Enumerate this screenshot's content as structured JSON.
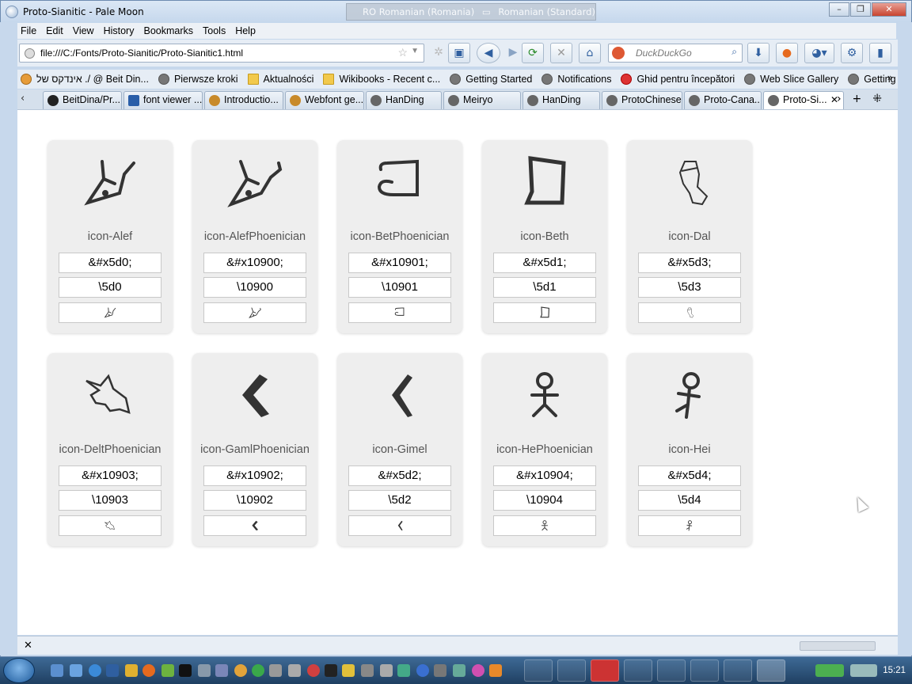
{
  "window": {
    "title": "Proto-Sianitic - Pale Moon",
    "language_bar": {
      "input": "RO Romanian (Romania)",
      "layout": "Romanian (Standard)"
    }
  },
  "menu": [
    "File",
    "Edit",
    "View",
    "History",
    "Bookmarks",
    "Tools",
    "Help"
  ],
  "nav": {
    "url": "file:///C:/Fonts/Proto-Sianitic/Proto-Sianitic1.html",
    "search_placeholder": "DuckDuckGo"
  },
  "bookmarks": [
    {
      "label": "אינדקס של ./ @ Beit Din...",
      "icon": "orange"
    },
    {
      "label": "Pierwsze kroki",
      "icon": "globe"
    },
    {
      "label": "Aktualności",
      "icon": "folder"
    },
    {
      "label": "Wikibooks - Recent c...",
      "icon": "folder"
    },
    {
      "label": "Getting Started",
      "icon": "globe"
    },
    {
      "label": "Notifications",
      "icon": "globe"
    },
    {
      "label": "Ghid pentru începători",
      "icon": "red"
    },
    {
      "label": "Web Slice Gallery",
      "icon": "globe"
    },
    {
      "label": "Getting Started",
      "icon": "globe"
    }
  ],
  "tabs": [
    "BeitDina/Pr...",
    "font viewer ...",
    "Introductio...",
    "Webfont ge...",
    "HanDing",
    "Meiryo",
    "HanDing",
    "ProtoChinese",
    "Proto-Cana...",
    "Proto-Si..."
  ],
  "cards": [
    {
      "name": "icon-Alef",
      "entity": "&#x5d0;",
      "css": "\\5d0",
      "glyph": "ox"
    },
    {
      "name": "icon-AlefPhoenician",
      "entity": "&#x10900;",
      "css": "\\10900",
      "glyph": "ox2"
    },
    {
      "name": "icon-BetPhoenician",
      "entity": "&#x10901;",
      "css": "\\10901",
      "glyph": "house"
    },
    {
      "name": "icon-Beth",
      "entity": "&#x5d1;",
      "css": "\\5d1",
      "glyph": "house2"
    },
    {
      "name": "icon-Dal",
      "entity": "&#x5d3;",
      "css": "\\5d3",
      "glyph": "door"
    },
    {
      "name": "icon-DeltPhoenician",
      "entity": "&#x10903;",
      "css": "\\10903",
      "glyph": "fish"
    },
    {
      "name": "icon-GamlPhoenician",
      "entity": "&#x10902;",
      "css": "\\10902",
      "glyph": "camel"
    },
    {
      "name": "icon-Gimel",
      "entity": "&#x5d2;",
      "css": "\\5d2",
      "glyph": "camel2"
    },
    {
      "name": "icon-HePhoenician",
      "entity": "&#x10904;",
      "css": "\\10904",
      "glyph": "man"
    },
    {
      "name": "icon-Hei",
      "entity": "&#x5d4;",
      "css": "\\5d4",
      "glyph": "man2"
    }
  ],
  "taskbar": {
    "clock": "15:21"
  }
}
